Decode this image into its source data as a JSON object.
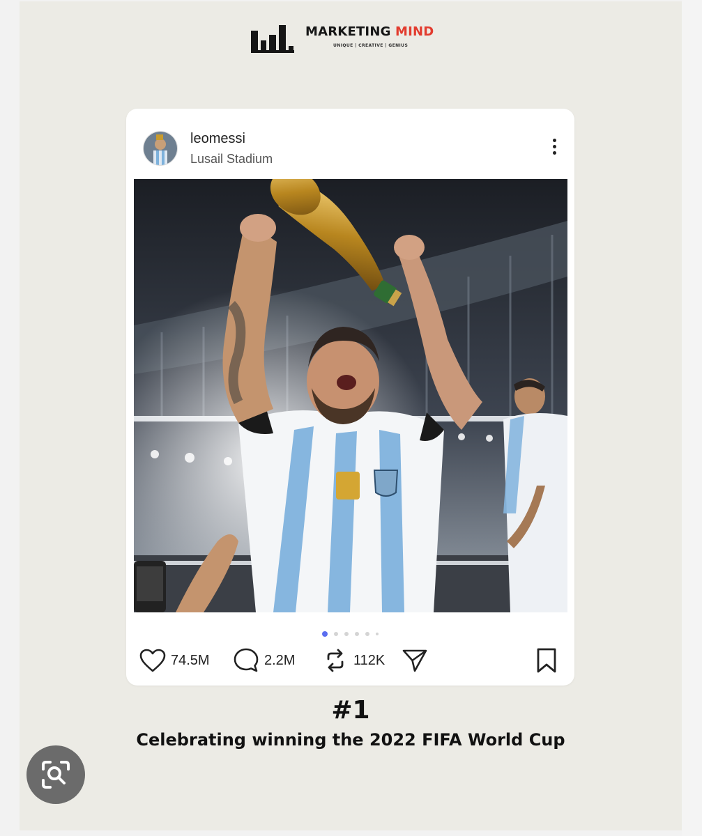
{
  "brand": {
    "title_main": "MARKETING",
    "title_accent": "MIND",
    "tagline": "UNIQUE | CREATIVE | GENIUS",
    "accent_color": "#e23b2e"
  },
  "post": {
    "username": "leomessi",
    "location": "Lusail Stadium",
    "carousel": {
      "total": 6,
      "active_index": 0
    },
    "likes": "74.5M",
    "comments": "2.2M",
    "reposts": "112K",
    "icons": {
      "more": "more-vertical-icon",
      "like": "heart-icon",
      "comment": "comment-icon",
      "repost": "repost-icon",
      "share": "send-icon",
      "save": "bookmark-icon"
    }
  },
  "rank": "#1",
  "caption": "Celebrating winning the 2022 FIFA World Cup",
  "overlay": {
    "lens_icon": "image-search-icon"
  }
}
